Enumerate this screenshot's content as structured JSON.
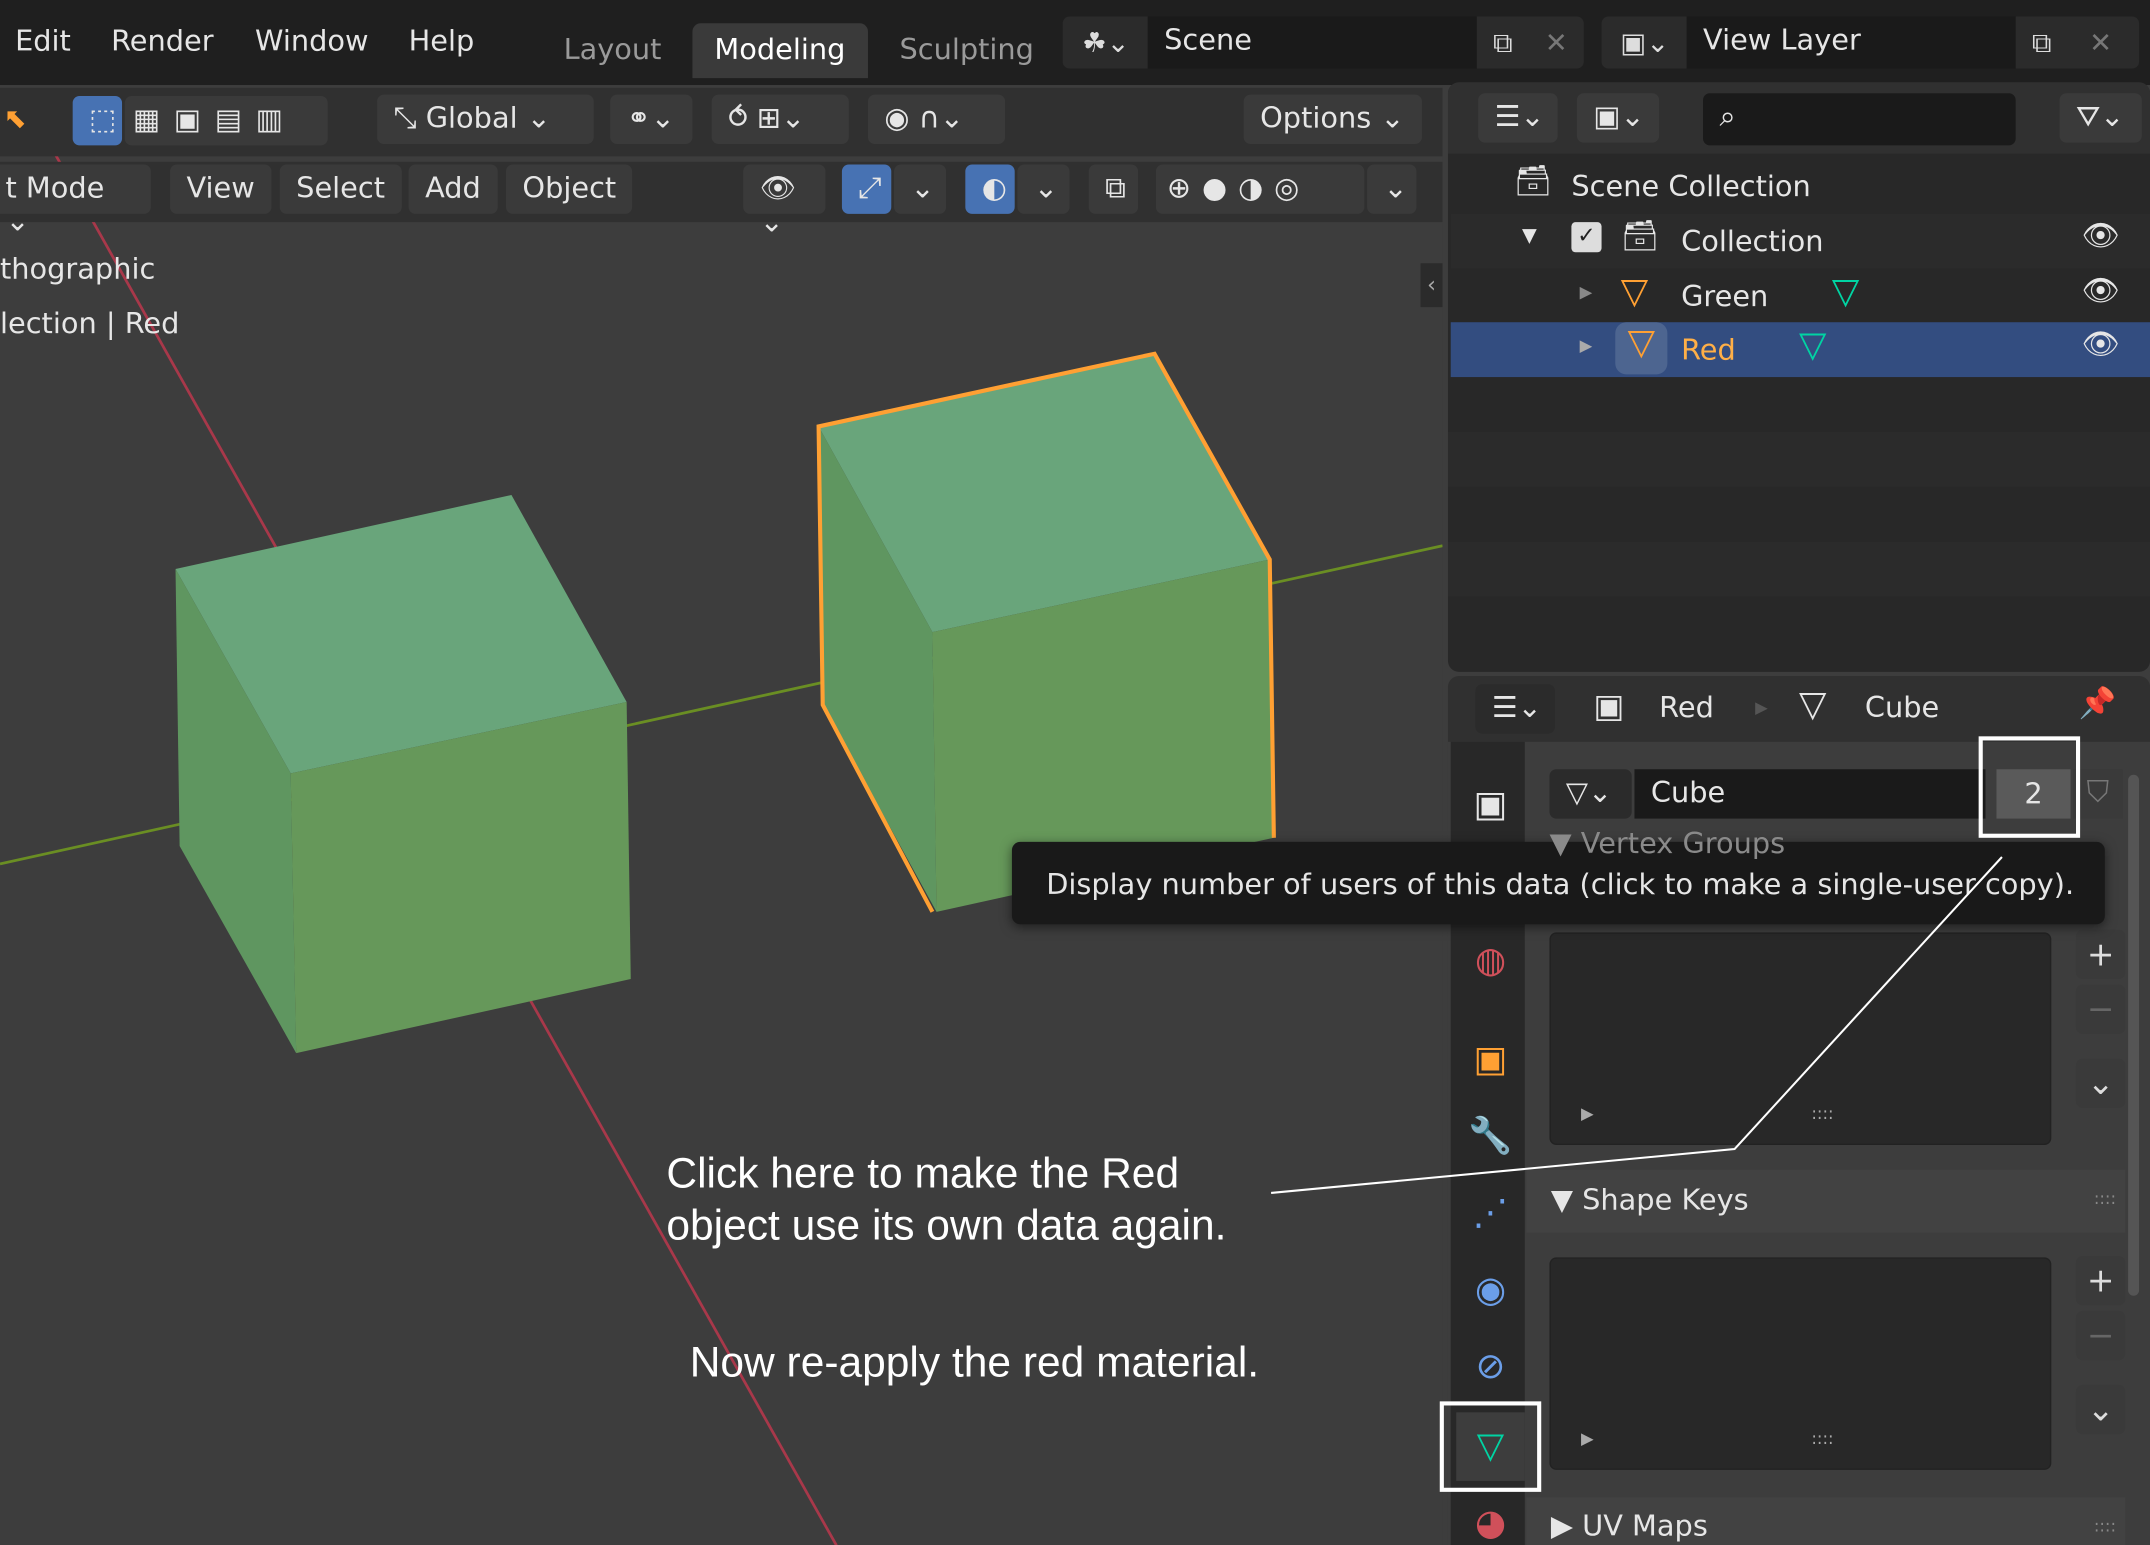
{
  "menu": [
    "Edit",
    "Render",
    "Window",
    "Help"
  ],
  "workspaces": [
    {
      "label": "Layout",
      "active": false
    },
    {
      "label": "Modeling",
      "active": true
    },
    {
      "label": "Sculpting",
      "active": false
    }
  ],
  "scene": {
    "value": "Scene"
  },
  "view_layer": {
    "value": "View Layer"
  },
  "viewport": {
    "orientation": "Global",
    "options": "Options",
    "mode": "t Mode",
    "header_menu": [
      "View",
      "Select",
      "Add",
      "Object"
    ],
    "overlay_lines": [
      "thographic",
      "lection | Red"
    ]
  },
  "outliner": {
    "items": [
      {
        "label": "Scene Collection",
        "icon": "scene-collection-icon"
      },
      {
        "label": "Collection",
        "icon": "collection-icon",
        "checked": true
      },
      {
        "label": "Green",
        "icon": "object-icon",
        "selected": false
      },
      {
        "label": "Red",
        "icon": "object-icon",
        "selected": true
      }
    ]
  },
  "properties": {
    "breadcrumb": [
      "Red",
      "Cube"
    ],
    "mesh_name": "Cube",
    "users": "2",
    "panels": [
      "Vertex Groups",
      "Shape Keys",
      "UV Maps"
    ],
    "list_grip": "::::"
  },
  "tooltip": "Display number of users of this data (click to make a single-user copy).",
  "annotations": [
    "Click here to make the Red",
    "object use its own data again.",
    "Now re-apply the red material."
  ],
  "colors": {
    "selected_row": "#334d80",
    "active_object": "#ffa033",
    "mesh_data": "#00d4a3",
    "cube": "#6aa276"
  }
}
